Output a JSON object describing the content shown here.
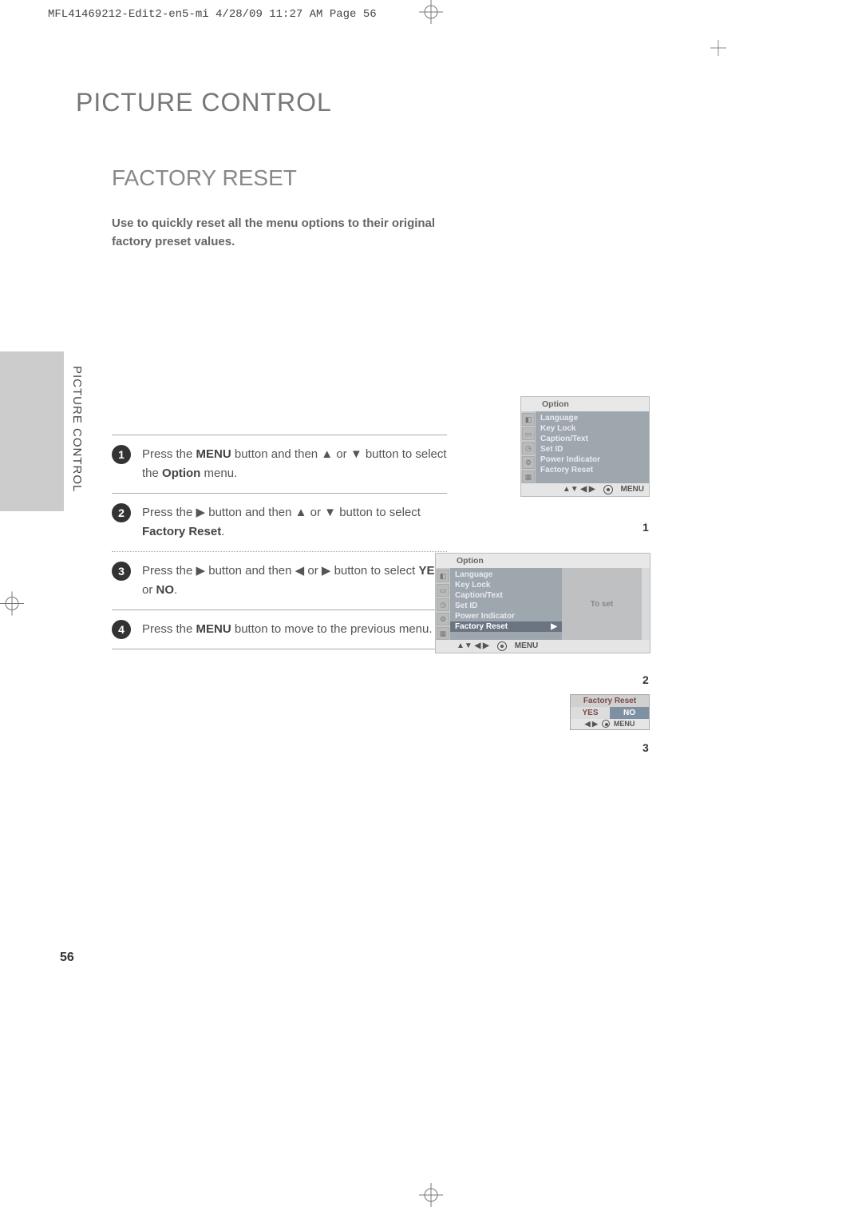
{
  "print_header": "MFL41469212-Edit2-en5-mi  4/28/09  11:27 AM  Page 56",
  "chapter_title": "PICTURE CONTROL",
  "side_tab": "PICTURE CONTROL",
  "section_title": "FACTORY RESET",
  "intro": "Use to quickly reset all the menu options to their original factory preset values.",
  "page_number": "56",
  "steps": [
    {
      "n": "1",
      "pre": "Press the ",
      "b1": "MENU",
      "mid": " button and then ▲ or ▼ button to select the ",
      "b2": "Option",
      "post": " menu."
    },
    {
      "n": "2",
      "pre": "Press the ▶ button and then ▲ or ▼ button to select ",
      "b1": "Factory Reset",
      "mid": "",
      "b2": "",
      "post": "."
    },
    {
      "n": "3",
      "pre": "Press the ▶ button and then ◀ or ▶ button to select ",
      "b1": "YES",
      "mid": " or ",
      "b2": "NO",
      "post": "."
    },
    {
      "n": "4",
      "pre": "Press the ",
      "b1": "MENU",
      "mid": " button to move to the previous menu.",
      "b2": "",
      "post": ""
    }
  ],
  "osd": {
    "title": "Option",
    "items": [
      "Language",
      "Key Lock",
      "Caption/Text",
      "Set ID",
      "Power Indicator",
      "Factory Reset"
    ],
    "to_set": "To set",
    "nav_arrows": "▲▼  ◀ ▶",
    "nav_menu": "MENU"
  },
  "confirm": {
    "title": "Factory Reset",
    "yes": "YES",
    "no": "NO",
    "nav": "◀ ▶",
    "menu": "MENU"
  },
  "refs": {
    "r1": "1",
    "r2": "2",
    "r3": "3"
  }
}
